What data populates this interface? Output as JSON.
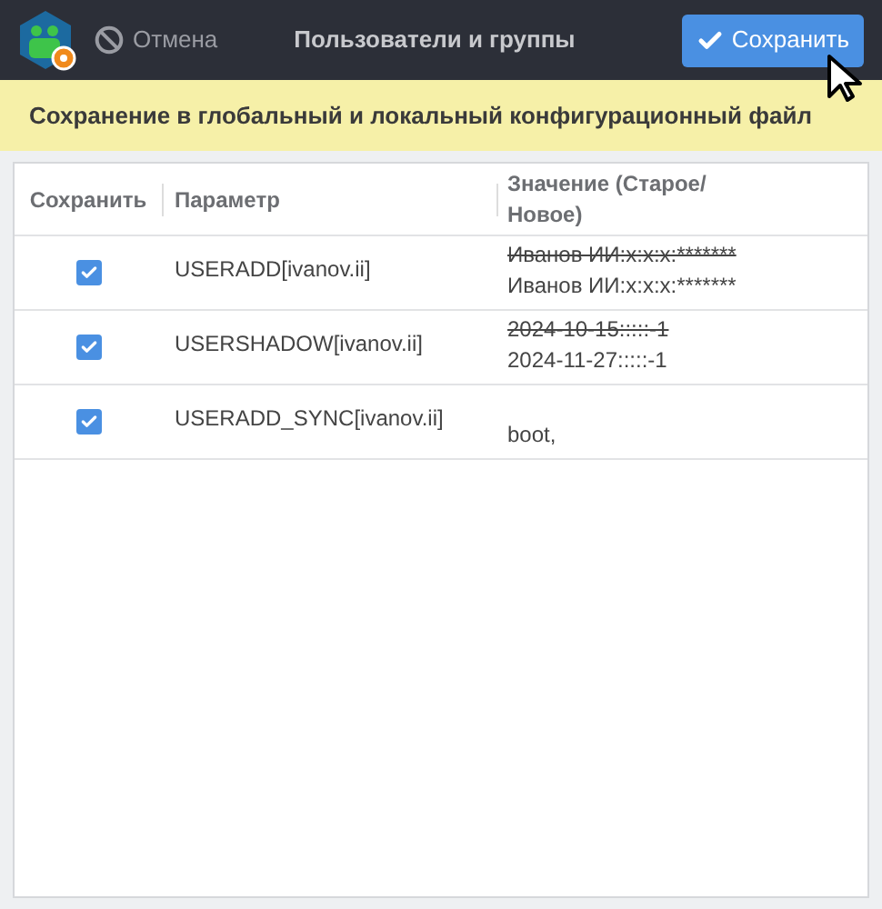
{
  "header": {
    "cancel": "Отмена",
    "title": "Пользователи и группы",
    "save": "Сохранить"
  },
  "banner": "Сохранение в глобальный и локальный конфигурационный файл",
  "table": {
    "columns": [
      "Сохранить",
      "Параметр",
      "Значение (Старое/Новое)"
    ],
    "rows": [
      {
        "checked": true,
        "parameter": "USERADD[ivanov.ii]",
        "old": "Иванов ИИ:x:x:x:*******",
        "new": "Иванов ИИ:x:x:x:*******"
      },
      {
        "checked": true,
        "parameter": "USERSHADOW[ivanov.ii]",
        "old": "2024-10-15:::::-1",
        "new": "2024-11-27:::::-1"
      },
      {
        "checked": true,
        "parameter": "USERADD_SYNC[ivanov.ii]",
        "new": "boot,"
      }
    ]
  }
}
